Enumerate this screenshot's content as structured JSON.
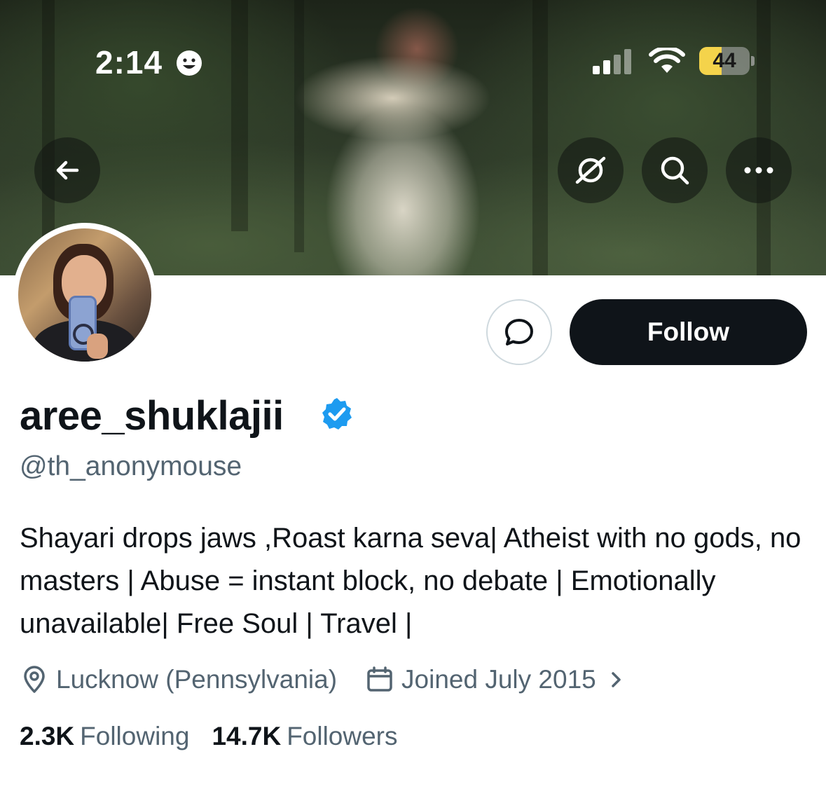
{
  "status_bar": {
    "time": "2:14",
    "battery": "44",
    "battery_level": 0.44
  },
  "banner": {
    "back_icon": "arrow-left-icon",
    "grok_icon": "grok-slash-icon",
    "search_icon": "search-icon",
    "more_icon": "more-horizontal-icon"
  },
  "profile": {
    "display_name": "aree_shuklajii",
    "handle": "@th_anonymouse",
    "verified": true,
    "bio": "Shayari drops jaws ,Roast karna seva| Atheist with no gods, no masters | Abuse = instant block, no debate | Emotionally unavailable| Free Soul | Travel |",
    "location": "Lucknow (Pennsylvania)",
    "joined": "Joined July 2015",
    "following_count": "2.3K",
    "following_label": "Following",
    "followers_count": "14.7K",
    "followers_label": "Followers"
  },
  "actions": {
    "follow_label": "Follow",
    "message_icon": "message-bubble-icon"
  },
  "colors": {
    "accent_verified": "#1d9bf0",
    "follow_bg": "#0f1419",
    "secondary_text": "#536471",
    "battery_fill": "#f4d34b"
  }
}
